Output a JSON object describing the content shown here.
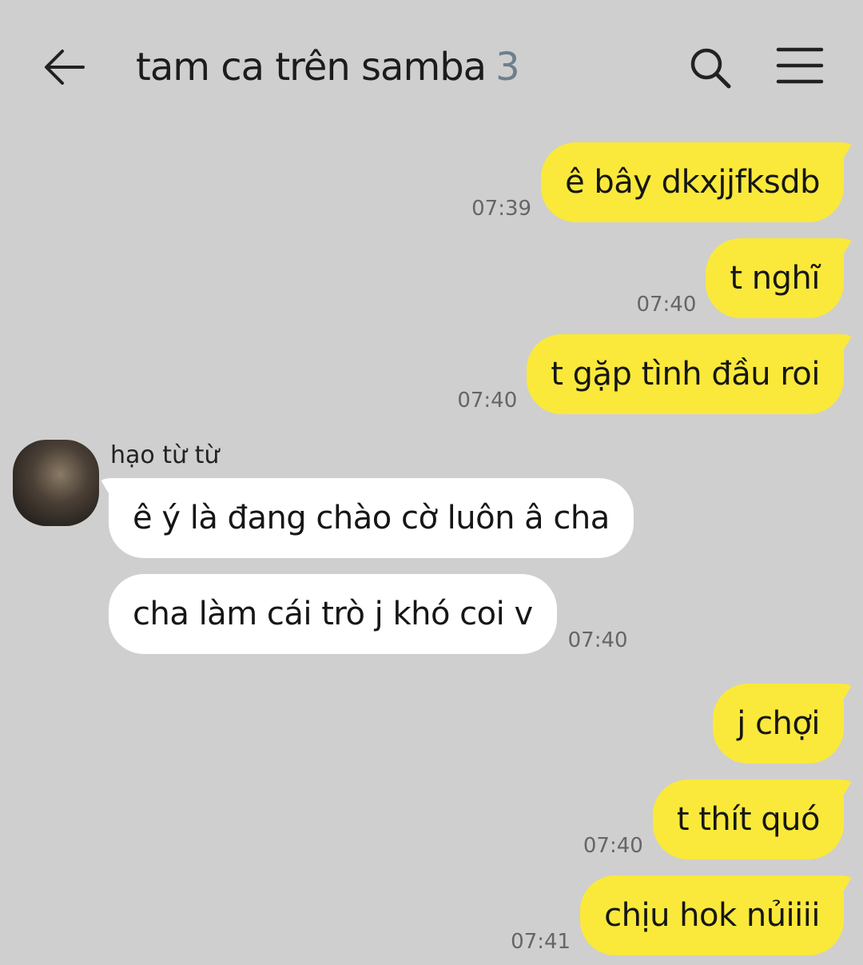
{
  "header": {
    "title": "tam ca trên samba",
    "member_count": "3"
  },
  "sender": {
    "name": "hạo từ từ"
  },
  "messages": [
    {
      "text": "ê bây dkxjjfksdb",
      "time": "07:39",
      "mine": true
    },
    {
      "text": "t nghĩ",
      "time": "07:40",
      "mine": true
    },
    {
      "text": "t gặp tình đầu roi",
      "time": "07:40",
      "mine": true
    },
    {
      "text": "ê ý là đang chào cờ luôn â cha",
      "time": "",
      "mine": false
    },
    {
      "text": "cha làm cái trò j khó coi v",
      "time": "07:40",
      "mine": false
    },
    {
      "text": "j chợi",
      "time": "",
      "mine": true
    },
    {
      "text": "t thít quó",
      "time": "07:40",
      "mine": true
    },
    {
      "text": "chịu hok nủiiii",
      "time": "07:41",
      "mine": true
    }
  ],
  "colors": {
    "background": "#cfcfcf",
    "my_bubble": "#fae93a",
    "their_bubble": "#ffffff"
  },
  "icons": {
    "back": "arrow-left-icon",
    "search": "search-icon",
    "menu": "hamburger-menu-icon"
  }
}
